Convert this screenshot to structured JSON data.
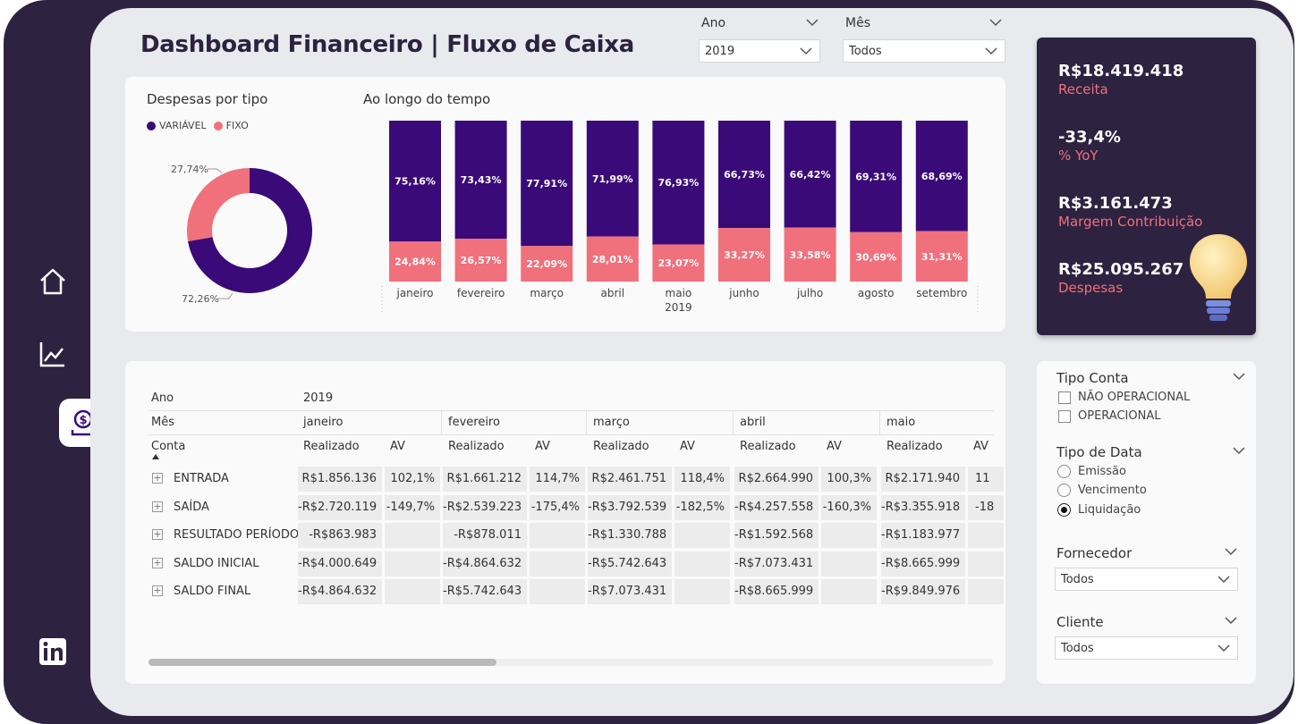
{
  "title": "Dashboard Financeiro | Fluxo de Caixa",
  "nav": {
    "icons": [
      "home-icon",
      "chart-line-icon",
      "money-icon",
      "linkedin-icon"
    ]
  },
  "slicers": {
    "ano": {
      "label": "Ano",
      "value": "2019"
    },
    "mes": {
      "label": "Mês",
      "value": "Todos"
    }
  },
  "donut": {
    "title": "Despesas por tipo",
    "legend": [
      {
        "name": "VARIÁVEL",
        "color": "#3a0a78"
      },
      {
        "name": "FIXO",
        "color": "#f0707b"
      }
    ],
    "labels": {
      "fixo": "27,74%",
      "variavel": "72,26%"
    }
  },
  "timeline": {
    "title": "Ao longo do tempo"
  },
  "chart_data": {
    "type": "bar",
    "stacked": "100%",
    "categories": [
      "janeiro",
      "fevereiro",
      "março",
      "abril",
      "maio",
      "junho",
      "julho",
      "agosto",
      "setembro"
    ],
    "year_label": "2019",
    "series": [
      {
        "name": "VARIÁVEL",
        "color": "#3a0a78",
        "values": [
          75.16,
          73.43,
          77.91,
          71.99,
          76.93,
          66.73,
          66.42,
          69.31,
          68.69
        ],
        "labels": [
          "75,16%",
          "73,43%",
          "77,91%",
          "71,99%",
          "76,93%",
          "66,73%",
          "66,42%",
          "69,31%",
          "68,69%"
        ]
      },
      {
        "name": "FIXO",
        "color": "#f0707b",
        "values": [
          24.84,
          26.57,
          22.09,
          28.01,
          23.07,
          33.27,
          33.58,
          30.69,
          31.31
        ],
        "labels": [
          "24,84%",
          "26,57%",
          "22,09%",
          "28,01%",
          "23,07%",
          "33,27%",
          "33,58%",
          "30,69%",
          "31,31%"
        ]
      }
    ],
    "donut": {
      "type": "pie",
      "values": [
        72.26,
        27.74
      ],
      "names": [
        "VARIÁVEL",
        "FIXO"
      ]
    }
  },
  "kpis": [
    {
      "value": "R$18.419.418",
      "label": "Receita"
    },
    {
      "value": "-33,4%",
      "label": "% YoY"
    },
    {
      "value": "R$3.161.473",
      "label": "Margem Contribuição"
    },
    {
      "value": "R$25.095.267",
      "label": "Despesas"
    }
  ],
  "table": {
    "header_ano": "Ano",
    "year": "2019",
    "header_mes": "Mês",
    "header_conta": "Conta",
    "months": [
      "janeiro",
      "fevereiro",
      "março",
      "abril",
      "maio"
    ],
    "sub_realizado": "Realizado",
    "sub_av": "AV",
    "rows": [
      {
        "name": "ENTRADA",
        "cells": [
          "R$1.856.136",
          "102,1%",
          "R$1.661.212",
          "114,7%",
          "R$2.461.751",
          "118,4%",
          "R$2.664.990",
          "100,3%",
          "R$2.171.940",
          "11"
        ]
      },
      {
        "name": "SAÍDA",
        "cells": [
          "-R$2.720.119",
          "-149,7%",
          "-R$2.539.223",
          "-175,4%",
          "-R$3.792.539",
          "-182,5%",
          "-R$4.257.558",
          "-160,3%",
          "-R$3.355.918",
          "-18"
        ]
      },
      {
        "name": "RESULTADO PERÍODO",
        "cells": [
          "-R$863.983",
          "",
          "-R$878.011",
          "",
          "-R$1.330.788",
          "",
          "-R$1.592.568",
          "",
          "-R$1.183.977",
          ""
        ]
      },
      {
        "name": "SALDO INICIAL",
        "cells": [
          "-R$4.000.649",
          "",
          "-R$4.864.632",
          "",
          "-R$5.742.643",
          "",
          "-R$7.073.431",
          "",
          "-R$8.665.999",
          ""
        ]
      },
      {
        "name": "SALDO FINAL",
        "cells": [
          "-R$4.864.632",
          "",
          "-R$5.742.643",
          "",
          "-R$7.073.431",
          "",
          "-R$8.665.999",
          "",
          "-R$9.849.976",
          ""
        ]
      }
    ]
  },
  "filters": {
    "tipo_conta": {
      "title": "Tipo Conta",
      "options": [
        "NÃO OPERACIONAL",
        "OPERACIONAL"
      ]
    },
    "tipo_data": {
      "title": "Tipo de Data",
      "options": [
        "Emissão",
        "Vencimento",
        "Liquidação"
      ],
      "selected": "Liquidação"
    },
    "fornecedor": {
      "title": "Fornecedor",
      "value": "Todos"
    },
    "cliente": {
      "title": "Cliente",
      "value": "Todos"
    }
  }
}
